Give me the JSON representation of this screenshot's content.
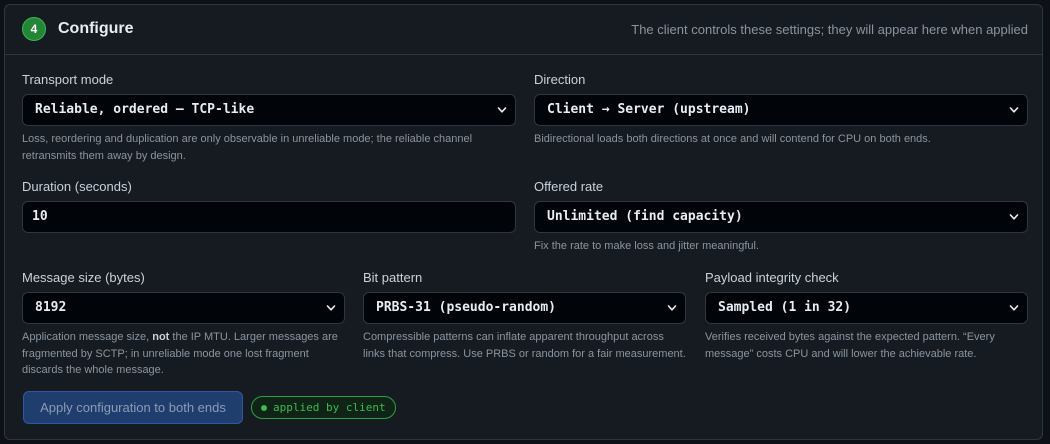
{
  "header": {
    "step": "4",
    "title": "Configure",
    "hint": "The client controls these settings; they will appear here when applied"
  },
  "transport": {
    "label": "Transport mode",
    "value": "Reliable, ordered — TCP-like",
    "help": "Loss, reordering and duplication are only observable in unreliable mode; the reliable channel retransmits them away by design."
  },
  "direction": {
    "label": "Direction",
    "value": "Client → Server (upstream)",
    "help": "Bidirectional loads both directions at once and will contend for CPU on both ends."
  },
  "duration": {
    "label": "Duration (seconds)",
    "value": "10"
  },
  "rate": {
    "label": "Offered rate",
    "value": "Unlimited (find capacity)",
    "help": "Fix the rate to make loss and jitter meaningful."
  },
  "message_size": {
    "label": "Message size (bytes)",
    "value": "8192",
    "help_prefix": "Application message size, ",
    "help_bold": "not",
    "help_suffix": " the IP MTU. Larger messages are fragmented by SCTP; in unreliable mode one lost fragment discards the whole message."
  },
  "bit_pattern": {
    "label": "Bit pattern",
    "value": "PRBS-31 (pseudo-random)",
    "help": "Compressible patterns can inflate apparent throughput across links that compress. Use PRBS or random for a fair measurement."
  },
  "integrity": {
    "label": "Payload integrity check",
    "value": "Sampled (1 in 32)",
    "help": "Verifies received bytes against the expected pattern. “Every message” costs CPU and will lower the achievable rate."
  },
  "actions": {
    "apply_label": "Apply configuration to both ends",
    "status": "applied by client"
  },
  "colors": {
    "accent_green": "#3fb950",
    "button_blue": "#1f3e6e"
  }
}
